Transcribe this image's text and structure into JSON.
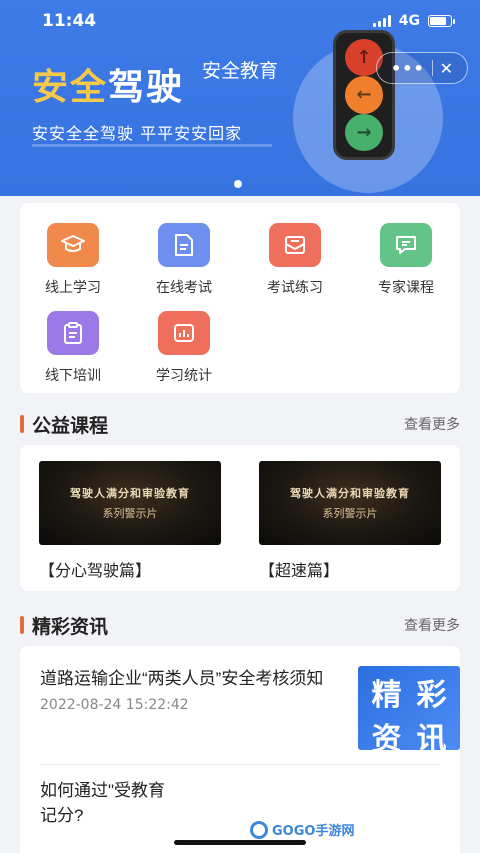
{
  "status": {
    "time": "11:44",
    "network": "4G",
    "battery_level": 0.8
  },
  "banner": {
    "title_part1": "安全",
    "title_part2": "驾驶",
    "subtitle": "安全教育",
    "slogan": "安安全全驾驶  平平安安回家",
    "capsule_more": "•••",
    "capsule_close": "✕",
    "traffic_light": [
      "red-up-arrow",
      "orange-left-arrow",
      "green-right-arrow"
    ]
  },
  "menu": {
    "items": [
      {
        "label": "线上学习",
        "icon": "graduation-cap-icon",
        "color": "#f0894b"
      },
      {
        "label": "在线考试",
        "icon": "document-icon",
        "color": "#6f8ff0"
      },
      {
        "label": "考试练习",
        "icon": "envelope-icon",
        "color": "#ee6f5c"
      },
      {
        "label": "专家课程",
        "icon": "chat-icon",
        "color": "#63c48a"
      },
      {
        "label": "线下培训",
        "icon": "clipboard-icon",
        "color": "#9a79e6"
      },
      {
        "label": "学习统计",
        "icon": "chart-icon",
        "color": "#ee6f5c"
      }
    ]
  },
  "courses": {
    "title": "公益课程",
    "see_more": "查看更多",
    "items": [
      {
        "thumb_line1": "驾驶人满分和审验教育",
        "thumb_line2": "系列警示片",
        "title": "【分心驾驶篇】"
      },
      {
        "thumb_line1": "驾驶人满分和审验教育",
        "thumb_line2": "系列警示片",
        "title": "【超速篇】"
      }
    ]
  },
  "news": {
    "title": "精彩资讯",
    "see_more": "查看更多",
    "thumb_chars": [
      "精",
      "彩",
      "资",
      "讯"
    ],
    "items": [
      {
        "title": "道路运输企业“两类人员”安全考核须知",
        "time": "2022-08-24 15:22:42"
      },
      {
        "title": "如何通过\"受教育\"减免交通违法记分?",
        "time": ""
      }
    ],
    "second_item_visible": "如何通过\"受教育\n记分?"
  },
  "watermark": {
    "text": "GOGO手游网"
  },
  "colors": {
    "banner": "#3f7be7",
    "accent_bar": "#e36c3a",
    "title_yellow": "#f7c948"
  }
}
